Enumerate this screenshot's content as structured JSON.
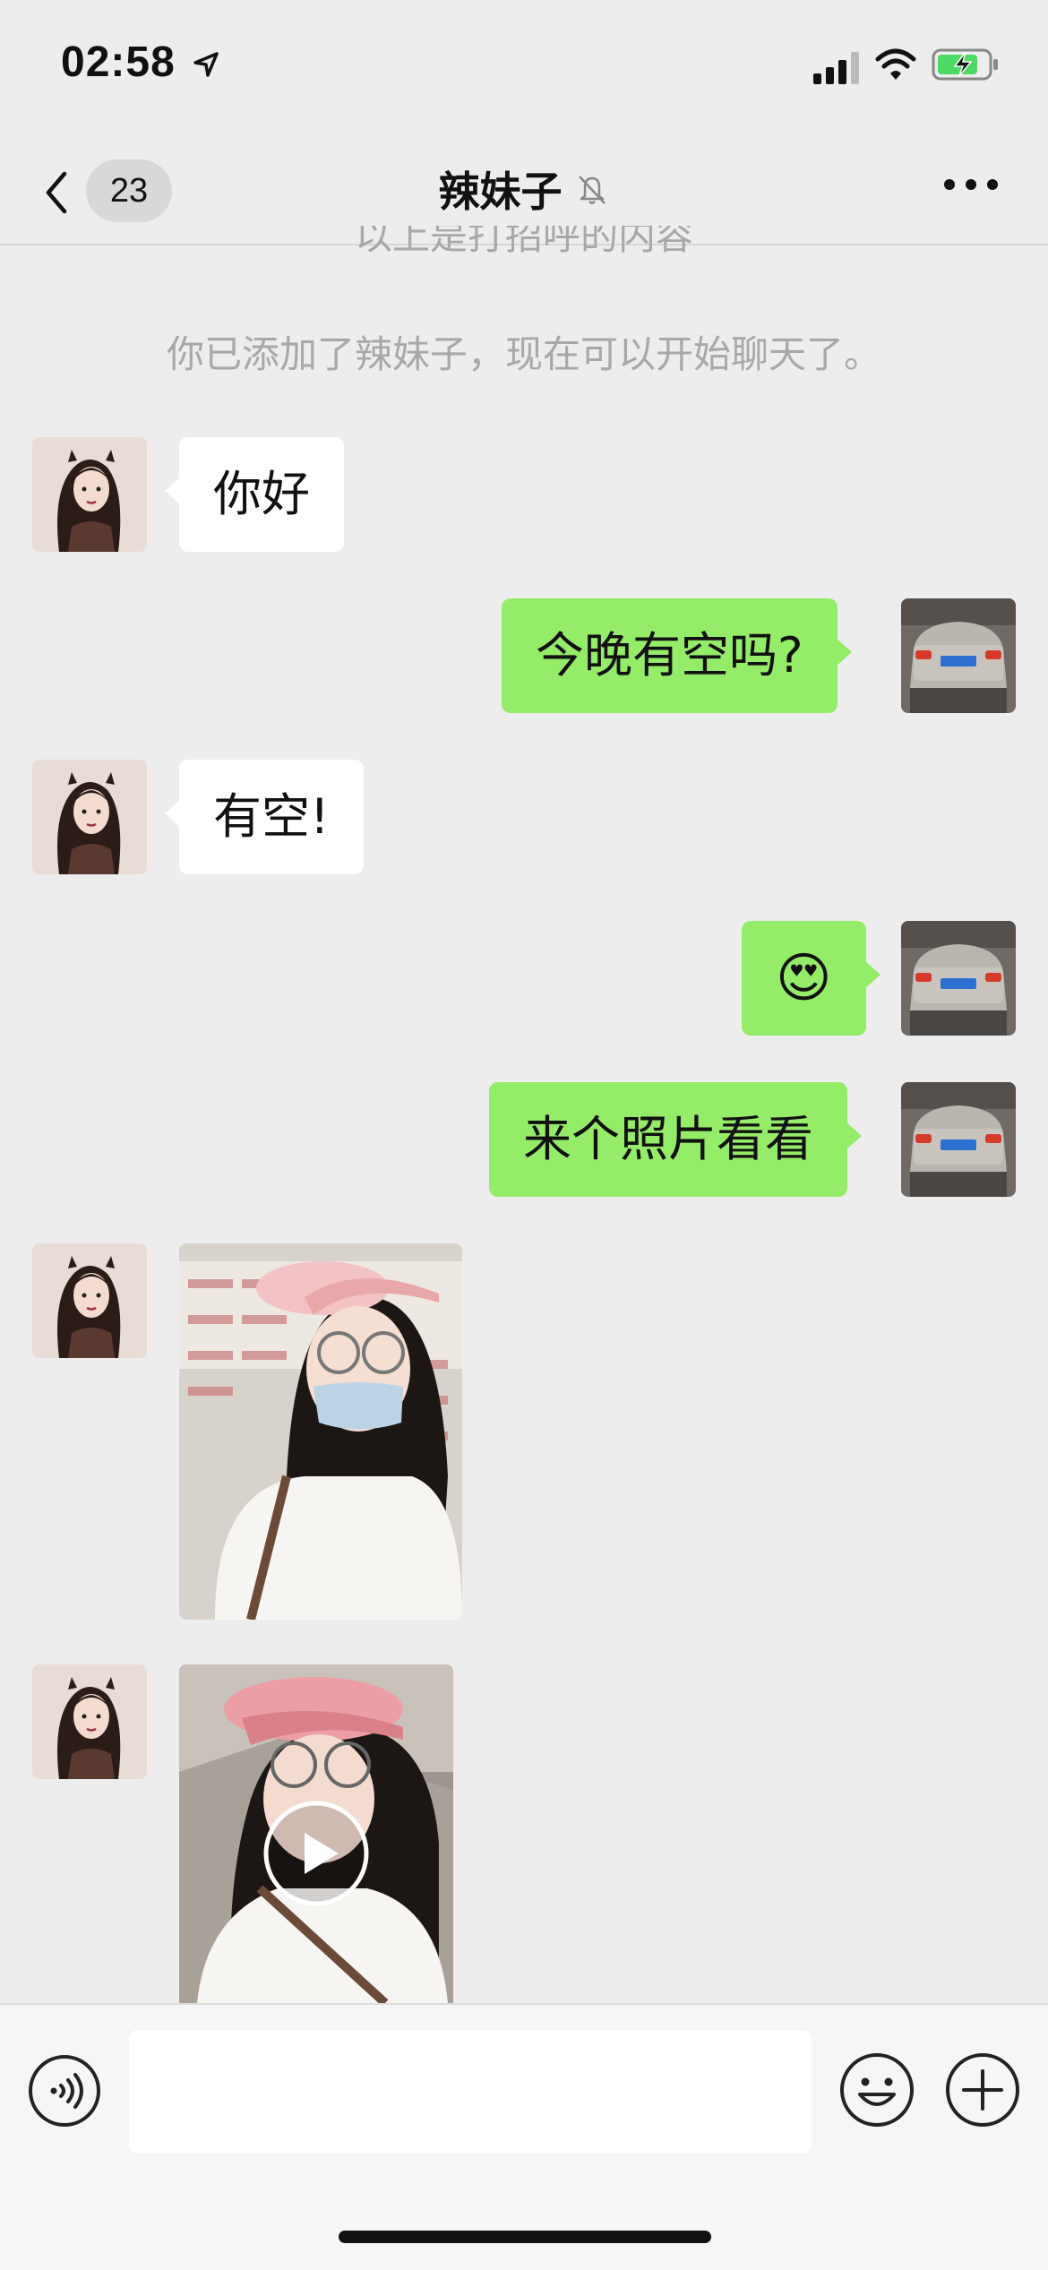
{
  "status_bar": {
    "time": "02:58"
  },
  "nav": {
    "unread_count": "23",
    "title": "辣妹子"
  },
  "system": {
    "greeting_note": "以上是打招呼的内容",
    "added_note": "你已添加了辣妹子，现在可以开始聊天了。"
  },
  "messages": [
    {
      "side": "left",
      "text": "你好"
    },
    {
      "side": "right",
      "text": "今晚有空吗?"
    },
    {
      "side": "left",
      "text": "有空!"
    },
    {
      "side": "right",
      "text": "😍"
    },
    {
      "side": "right",
      "text": "来个照片看看"
    },
    {
      "side": "left",
      "type": "image"
    },
    {
      "side": "left",
      "type": "video"
    }
  ],
  "input": {
    "value": ""
  },
  "icons": [
    "location-arrow-icon",
    "signal-icon",
    "wifi-icon",
    "battery-charging-icon",
    "back-chevron-icon",
    "mute-bell-icon",
    "more-dots-icon",
    "voice-icon",
    "emoji-icon",
    "plus-icon",
    "play-icon"
  ],
  "colors": {
    "background": "#ededed",
    "outgoing_bubble": "#95ec69",
    "incoming_bubble": "#ffffff",
    "input_bar": "#f6f6f6"
  }
}
